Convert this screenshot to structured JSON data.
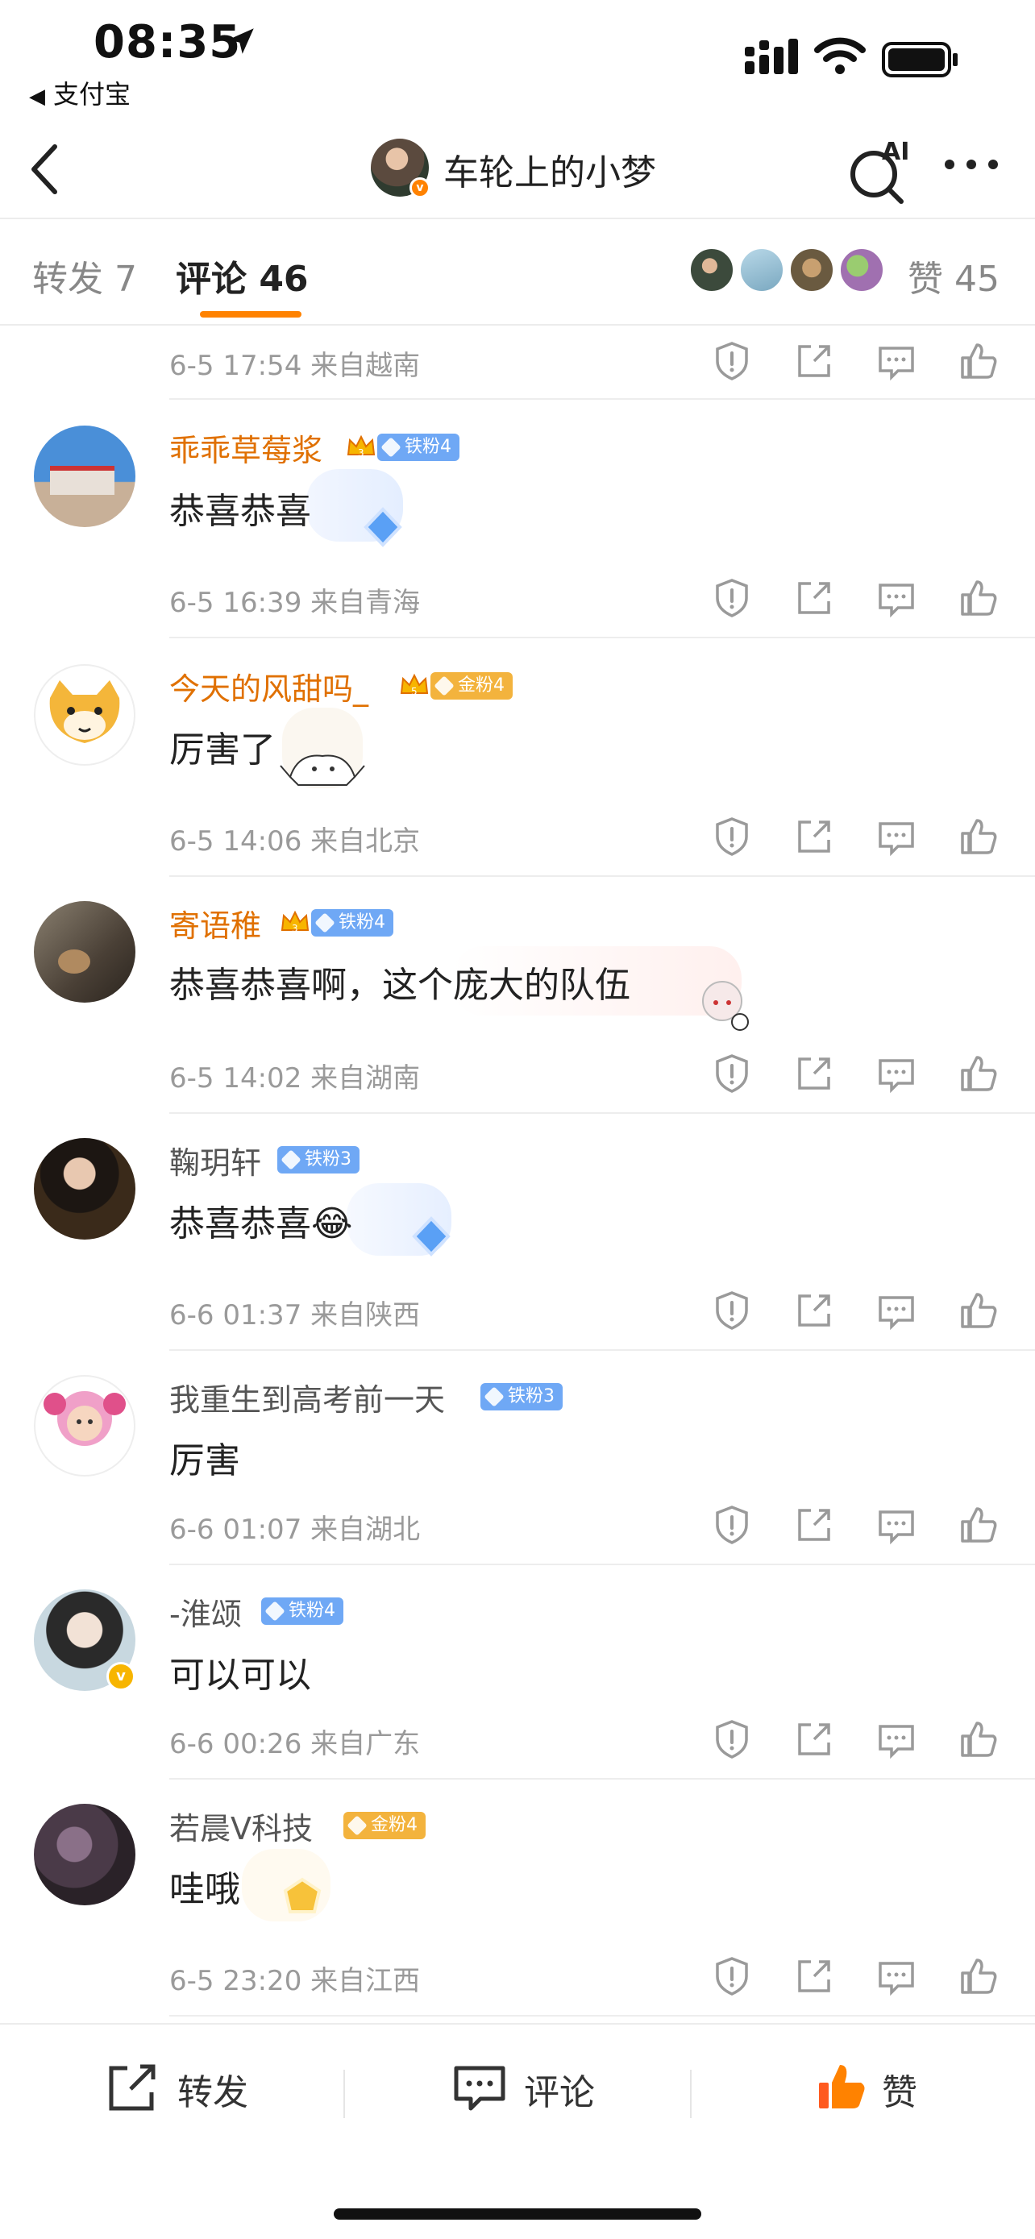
{
  "status_bar": {
    "time": "08:35",
    "back_app": "支付宝"
  },
  "nav": {
    "title": "车轮上的小梦",
    "ai_label": "AI"
  },
  "tabs": {
    "repost": "转发 7",
    "comment": "评论 46",
    "likes": "赞 45"
  },
  "comments": [
    {
      "meta": "6-5 17:54 来自越南"
    },
    {
      "name": "乖乖草莓浆",
      "badge": "铁粉4",
      "text": "恭喜恭喜",
      "meta": "6-5 16:39 来自青海"
    },
    {
      "name": "今天的风甜吗_",
      "badge": "金粉4",
      "text": "厉害了",
      "meta": "6-5 14:06 来自北京"
    },
    {
      "name": "寄语稚",
      "badge": "铁粉4",
      "text": "恭喜恭喜啊，这个庞大的队伍",
      "meta": "6-5 14:02 来自湖南"
    },
    {
      "name": "鞠玥轩",
      "badge": "铁粉3",
      "text": "恭喜恭喜",
      "emoji": "😂",
      "meta": "6-6 01:37 来自陕西"
    },
    {
      "name": "我重生到高考前一天",
      "badge": "铁粉3",
      "text": "厉害",
      "meta": "6-6 01:07 来自湖北"
    },
    {
      "name": "-淮颂",
      "badge": "铁粉4",
      "text": "可以可以",
      "meta": "6-6 00:26 来自广东"
    },
    {
      "name": "若晨V科技",
      "badge": "金粉4",
      "text": "哇哦",
      "meta": "6-5 23:20 来自江西"
    }
  ],
  "bottom_bar": {
    "repost": "转发",
    "comment": "评论",
    "like": "赞"
  },
  "colors": {
    "accent": "#ff8200",
    "gold_name": "#e07000",
    "iron_badge": "#6fa8f5",
    "gold_badge": "#f3b33d"
  }
}
